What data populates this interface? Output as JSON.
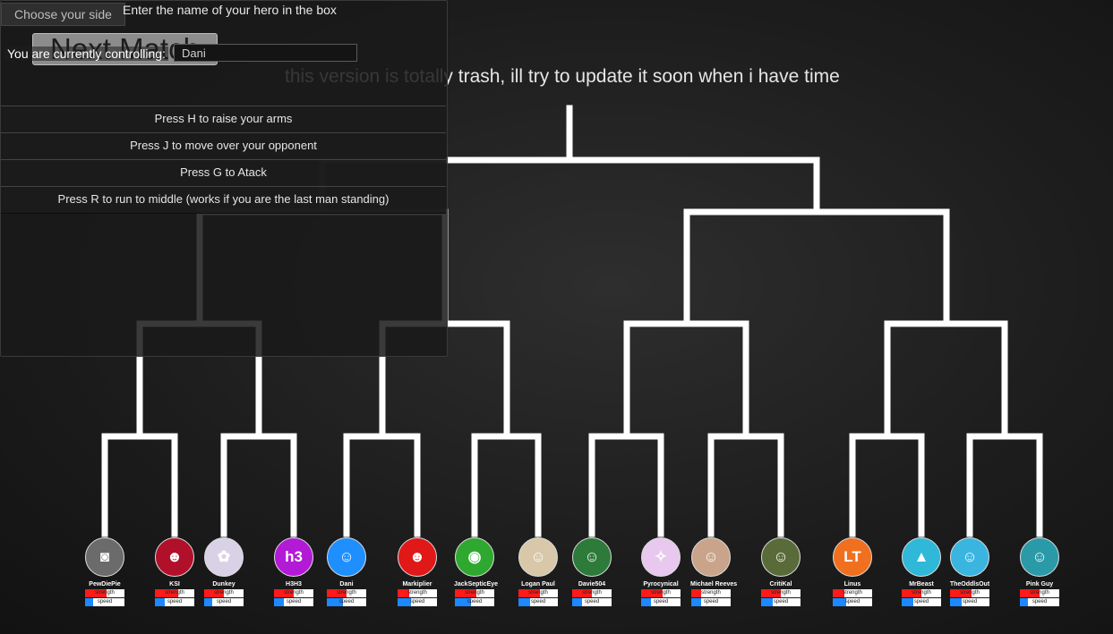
{
  "notice": "this version is totally trash, ill try to update it soon when i have time",
  "panel": {
    "side_button": "Choose your side",
    "prompt": "Enter the name of your hero in the box",
    "next_match": "Next Match",
    "controlling_label": "You are currently controlling:",
    "hero_input_value": "Dani",
    "help": [
      "Press H to raise your arms",
      "Press J to move over your opponent",
      "Press G to Atack",
      "Press R to run to middle (works if you are the last man standing)"
    ]
  },
  "stat_labels": {
    "strength": "strength",
    "speed": "speed"
  },
  "players": [
    {
      "name": "PewDiePie",
      "avatar_icon": "pewdiepie-avatar-icon",
      "avatar_color": "#6b6b6b",
      "glyph": "◙",
      "strength": 0.55,
      "speed": 0.2
    },
    {
      "name": "KSI",
      "avatar_icon": "ksi-avatar-icon",
      "avatar_color": "#b0102a",
      "glyph": "☻",
      "strength": 0.6,
      "speed": 0.25
    },
    {
      "name": "Dunkey",
      "avatar_icon": "dunkey-avatar-icon",
      "avatar_color": "#d9d2e6",
      "glyph": "✿",
      "strength": 0.5,
      "speed": 0.2
    },
    {
      "name": "H3H3",
      "avatar_icon": "h3h3-avatar-icon",
      "avatar_color": "#b21ad6",
      "glyph": "h3",
      "strength": 0.5,
      "speed": 0.25
    },
    {
      "name": "Dani",
      "avatar_icon": "dani-avatar-icon",
      "avatar_color": "#1f8fff",
      "glyph": "☺",
      "strength": 0.5,
      "speed": 0.4
    },
    {
      "name": "Markiplier",
      "avatar_icon": "markiplier-avatar-icon",
      "avatar_color": "#e01818",
      "glyph": "☻",
      "strength": 0.3,
      "speed": 0.35
    },
    {
      "name": "JackSepticEye",
      "avatar_icon": "jacksepticeye-avatar-icon",
      "avatar_color": "#2ea82e",
      "glyph": "◉",
      "strength": 0.55,
      "speed": 0.4
    },
    {
      "name": "Logan Paul",
      "avatar_icon": "logan-paul-avatar-icon",
      "avatar_color": "#d8c7a8",
      "glyph": "☺",
      "strength": 0.55,
      "speed": 0.3
    },
    {
      "name": "Davie504",
      "avatar_icon": "davie504-avatar-icon",
      "avatar_color": "#2d7a3a",
      "glyph": "☺",
      "strength": 0.5,
      "speed": 0.25
    },
    {
      "name": "Pyrocynical",
      "avatar_icon": "pyrocynical-avatar-icon",
      "avatar_color": "#e8c8ee",
      "glyph": "✧",
      "strength": 0.55,
      "speed": 0.25
    },
    {
      "name": "Michael Reeves",
      "avatar_icon": "michael-reeves-avatar-icon",
      "avatar_color": "#c9a48a",
      "glyph": "☺",
      "strength": 0.25,
      "speed": 0.25
    },
    {
      "name": "CritiKal",
      "avatar_icon": "critikal-avatar-icon",
      "avatar_color": "#5a6b3a",
      "glyph": "☺",
      "strength": 0.5,
      "speed": 0.3
    },
    {
      "name": "Linus",
      "avatar_icon": "linus-avatar-icon",
      "avatar_color": "#f07020",
      "glyph": "LT",
      "strength": 0.3,
      "speed": 0.35
    },
    {
      "name": "MrBeast",
      "avatar_icon": "mrbeast-avatar-icon",
      "avatar_color": "#2fb8d8",
      "glyph": "▲",
      "strength": 0.5,
      "speed": 0.3
    },
    {
      "name": "TheOddlsOut",
      "avatar_icon": "theoddlsout-avatar-icon",
      "avatar_color": "#3ab5e0",
      "glyph": "☺",
      "strength": 0.55,
      "speed": 0.3
    },
    {
      "name": "Pink Guy",
      "avatar_icon": "pink-guy-avatar-icon",
      "avatar_color": "#2a9aa8",
      "glyph": "☺",
      "strength": 0.5,
      "speed": 0.2
    }
  ]
}
